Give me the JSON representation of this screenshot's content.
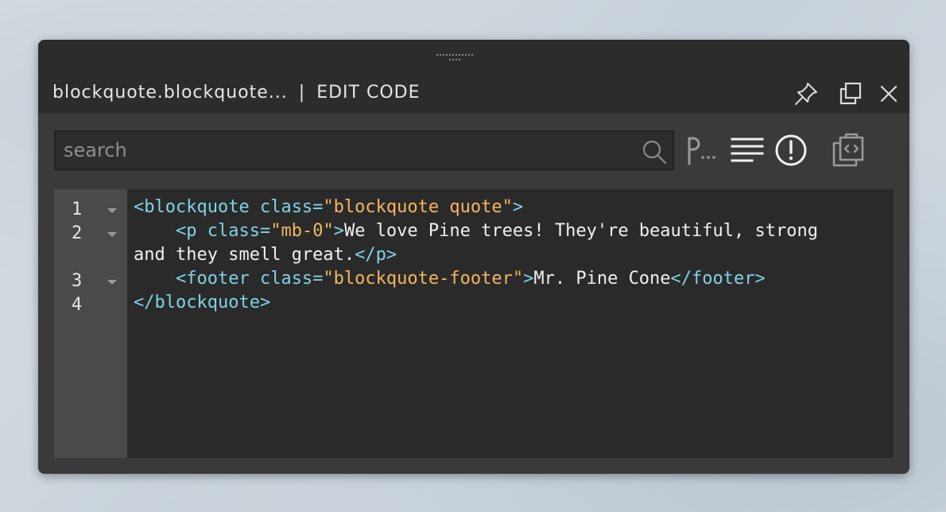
{
  "window": {
    "title": "blockquote.blockquote...",
    "separator": "|",
    "mode": "EDIT CODE",
    "icons": [
      "pin-icon",
      "restore-window-icon",
      "close-icon"
    ]
  },
  "search": {
    "placeholder": "search",
    "value": ""
  },
  "toolbar": {
    "paragraph_label": "p...",
    "icons": [
      "paragraph-icon",
      "wrap-lines-icon",
      "warning-icon",
      "code-clipboard-icon"
    ]
  },
  "editor": {
    "line_numbers": [
      "1",
      "2",
      "3",
      "4"
    ],
    "lines": [
      {
        "tokens": [
          {
            "t": "<blockquote",
            "c": "tag"
          },
          {
            "t": " ",
            "c": "txt"
          },
          {
            "t": "class",
            "c": "attr"
          },
          {
            "t": "=",
            "c": "attr"
          },
          {
            "t": "\"blockquote quote\"",
            "c": "val"
          },
          {
            "t": ">",
            "c": "tag"
          }
        ]
      },
      {
        "tokens": [
          {
            "t": "    ",
            "c": "txt"
          },
          {
            "t": "<p",
            "c": "tag"
          },
          {
            "t": " ",
            "c": "txt"
          },
          {
            "t": "class",
            "c": "attr"
          },
          {
            "t": "=",
            "c": "attr"
          },
          {
            "t": "\"mb-0\"",
            "c": "val"
          },
          {
            "t": ">",
            "c": "tag"
          },
          {
            "t": "We love Pine trees! They're beautiful, strong",
            "c": "txt"
          }
        ]
      },
      {
        "tokens": [
          {
            "t": "and they smell great.",
            "c": "txt"
          },
          {
            "t": "</p>",
            "c": "tag"
          }
        ]
      },
      {
        "tokens": [
          {
            "t": "    ",
            "c": "txt"
          },
          {
            "t": "<footer",
            "c": "tag"
          },
          {
            "t": " ",
            "c": "txt"
          },
          {
            "t": "class",
            "c": "attr"
          },
          {
            "t": "=",
            "c": "attr"
          },
          {
            "t": "\"blockquote-footer\"",
            "c": "val"
          },
          {
            "t": ">",
            "c": "tag"
          },
          {
            "t": "Mr. Pine Cone",
            "c": "txt"
          },
          {
            "t": "</footer>",
            "c": "tag"
          }
        ]
      },
      {
        "tokens": [
          {
            "t": "</blockquote>",
            "c": "tag"
          }
        ]
      }
    ]
  },
  "colors": {
    "tag": "#7fd3e3",
    "value": "#f3b660",
    "text": "#f0f0f0",
    "panel": "#3a3a3a",
    "titlebar": "#2c2c2c",
    "gutter": "#4a4a4a",
    "editor_bg": "#2a2a2a"
  }
}
